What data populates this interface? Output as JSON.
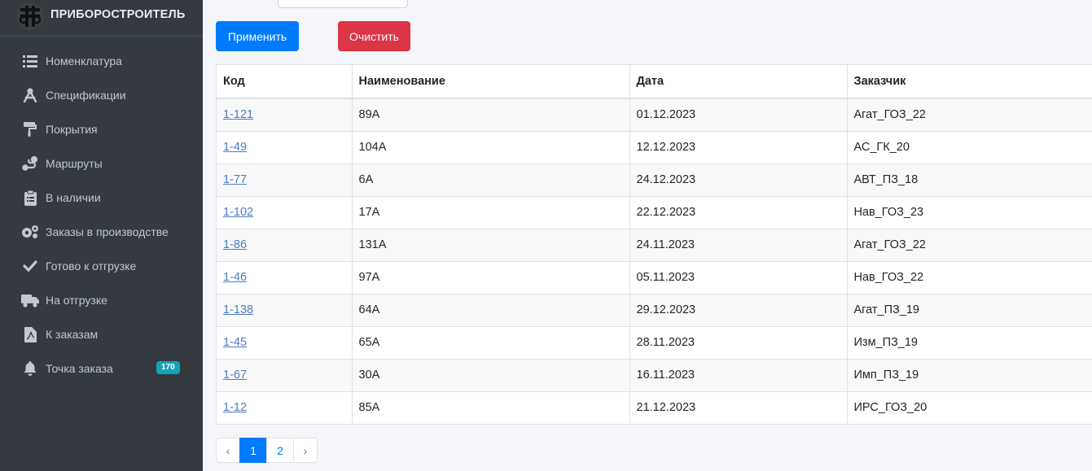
{
  "brand": {
    "name": "ПРИБОРОСТРОИТЕЛЬ"
  },
  "sidebar": {
    "items": [
      {
        "label": "Номенклатура",
        "icon": "list-icon"
      },
      {
        "label": "Спецификации",
        "icon": "compass-icon"
      },
      {
        "label": "Покрытия",
        "icon": "paint-roller-icon"
      },
      {
        "label": "Маршруты",
        "icon": "route-icon"
      },
      {
        "label": "В наличии",
        "icon": "clipboard-icon"
      },
      {
        "label": "Заказы в производстве",
        "icon": "cogs-icon"
      },
      {
        "label": "Готово к отгрузке",
        "icon": "check-icon"
      },
      {
        "label": "На отгрузке",
        "icon": "truck-icon"
      },
      {
        "label": "К заказам",
        "icon": "file-icon"
      },
      {
        "label": "Точка заказа",
        "icon": "bell-icon",
        "badge": "170"
      }
    ]
  },
  "filters": {
    "apply_label": "Применить",
    "clear_label": "Очистить"
  },
  "table": {
    "headers": [
      "Код",
      "Наименование",
      "Дата",
      "Заказчик"
    ],
    "rows": [
      [
        "1-121",
        "89А",
        "01.12.2023",
        "Агат_ГОЗ_22"
      ],
      [
        "1-49",
        "104А",
        "12.12.2023",
        "АС_ГК_20"
      ],
      [
        "1-77",
        "6А",
        "24.12.2023",
        "АВТ_ПЗ_18"
      ],
      [
        "1-102",
        "17А",
        "22.12.2023",
        "Нав_ГОЗ_23"
      ],
      [
        "1-86",
        "131А",
        "24.11.2023",
        "Агат_ГОЗ_22"
      ],
      [
        "1-46",
        "97А",
        "05.11.2023",
        "Нав_ГОЗ_22"
      ],
      [
        "1-138",
        "64А",
        "29.12.2023",
        "Агат_ПЗ_19"
      ],
      [
        "1-45",
        "65А",
        "28.11.2023",
        "Изм_ПЗ_19"
      ],
      [
        "1-67",
        "30А",
        "16.11.2023",
        "Имп_ПЗ_19"
      ],
      [
        "1-12",
        "85А",
        "21.12.2023",
        "ИРС_ГОЗ_20"
      ]
    ]
  },
  "pagination": {
    "prev": "‹",
    "pages": [
      "1",
      "2"
    ],
    "active": "1",
    "next": "›"
  },
  "colors": {
    "primary": "#007bff",
    "danger": "#dc3545",
    "sidebar": "#343a40",
    "badge": "#17a2b8",
    "link": "#4a7cc7"
  }
}
